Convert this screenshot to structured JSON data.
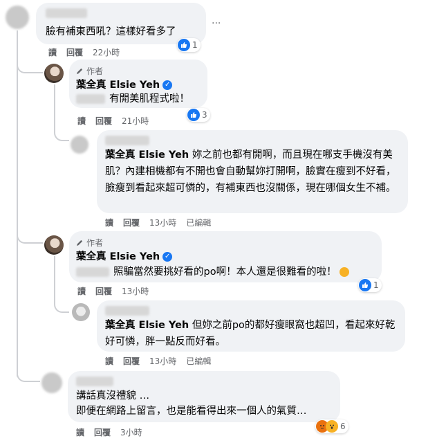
{
  "actions": {
    "read": "讀",
    "reply": "回覆",
    "edited": "已編輯"
  },
  "author_tag": "作者",
  "author_name": "葉全真 Elsie Yeh",
  "comments": [
    {
      "text": "臉有補東西吼？這樣好看多了",
      "time": "22小時",
      "reactions": "1"
    },
    {
      "text": "有開美肌程式啦！",
      "time": "21小時",
      "reactions": "3"
    },
    {
      "text": "妳之前也都有開啊，而且現在哪支手機沒有美肌？內建相機都有不開也會自動幫妳打開啊，臉實在瘦到不好看，臉瘦到看起來超可憐的，有補東西也沒關係，現在哪個女生不補。",
      "time": "13小時"
    },
    {
      "text": "照騙當然要挑好看的po啊！本人還是很難看的啦！",
      "time": "13小時",
      "reactions": "1"
    },
    {
      "text": "但妳之前po的都好瘦眼窩也超凹，看起來好乾好可憐，胖一點反而好看。",
      "time": "13小時"
    },
    {
      "line1": "講話真沒禮貌 …",
      "line2": "即便在網路上留言，也是能看得出來一個人的氣質…",
      "time": "3小時",
      "reactions": "6"
    }
  ],
  "more_options": "···",
  "colors": {
    "bubble": "#f0f2f5",
    "meta": "#65676b",
    "like_blue": "#1877f2",
    "text": "#050505"
  }
}
